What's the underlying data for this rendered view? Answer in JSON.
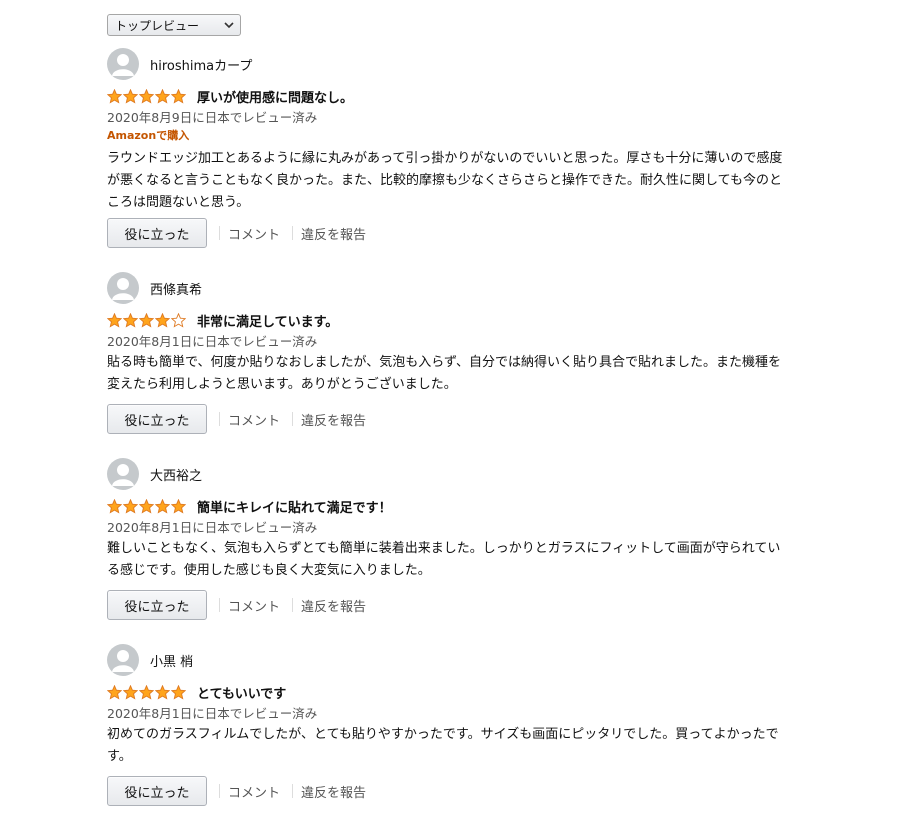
{
  "sort": {
    "selected": "トップレビュー"
  },
  "colors": {
    "star": "#ffa41c",
    "vp_badge": "#c45500",
    "link": "#555555"
  },
  "reviews": [
    {
      "author": "hiroshimaカープ",
      "rating": 5,
      "title": "厚いが使用感に問題なし。",
      "meta": "2020年8月9日に日本でレビュー済み",
      "verified": "Amazonで購入",
      "body_lines": [
        "ラウンドエッジ加工とあるように縁に丸みがあって引っ掛かりがないのでいいと思った。厚さも十分に薄いので感度",
        "が悪くなると言うこともなく良かった。また、比較的摩擦も少なくさらさらと操作できた。耐久性に関しても今のと",
        "ころは問題ないと思う。"
      ],
      "helpful_label": "役に立った",
      "comment_label": "コメント",
      "report_label": "違反を報告"
    },
    {
      "author": "西條真希",
      "rating": 4,
      "title": "非常に満足しています。",
      "meta": "2020年8月1日に日本でレビュー済み",
      "verified": "",
      "body_lines": [
        "貼る時も簡単で、何度か貼りなおしましたが、気泡も入らず、自分では納得いく貼り具合で貼れました。また機種を",
        "変えたら利用しようと思います。ありがとうございました。"
      ],
      "helpful_label": "役に立った",
      "comment_label": "コメント",
      "report_label": "違反を報告"
    },
    {
      "author": "大西裕之",
      "rating": 5,
      "title": "簡単にキレイに貼れて満足です！",
      "meta": "2020年8月1日に日本でレビュー済み",
      "verified": "",
      "body_lines": [
        "難しいこともなく、気泡も入らずとても簡単に装着出来ました。しっかりとガラスにフィットして画面が守られてい",
        "る感じです。使用した感じも良く大変気に入りました。"
      ],
      "helpful_label": "役に立った",
      "comment_label": "コメント",
      "report_label": "違反を報告"
    },
    {
      "author": "小黒 梢",
      "rating": 5,
      "title": "とてもいいです",
      "meta": "2020年8月1日に日本でレビュー済み",
      "verified": "",
      "body_lines": [
        "初めてのガラスフィルムでしたが、とても貼りやすかったです。サイズも画面にピッタリでした。買ってよかったで",
        "す。"
      ],
      "helpful_label": "役に立った",
      "comment_label": "コメント",
      "report_label": "違反を報告"
    }
  ]
}
